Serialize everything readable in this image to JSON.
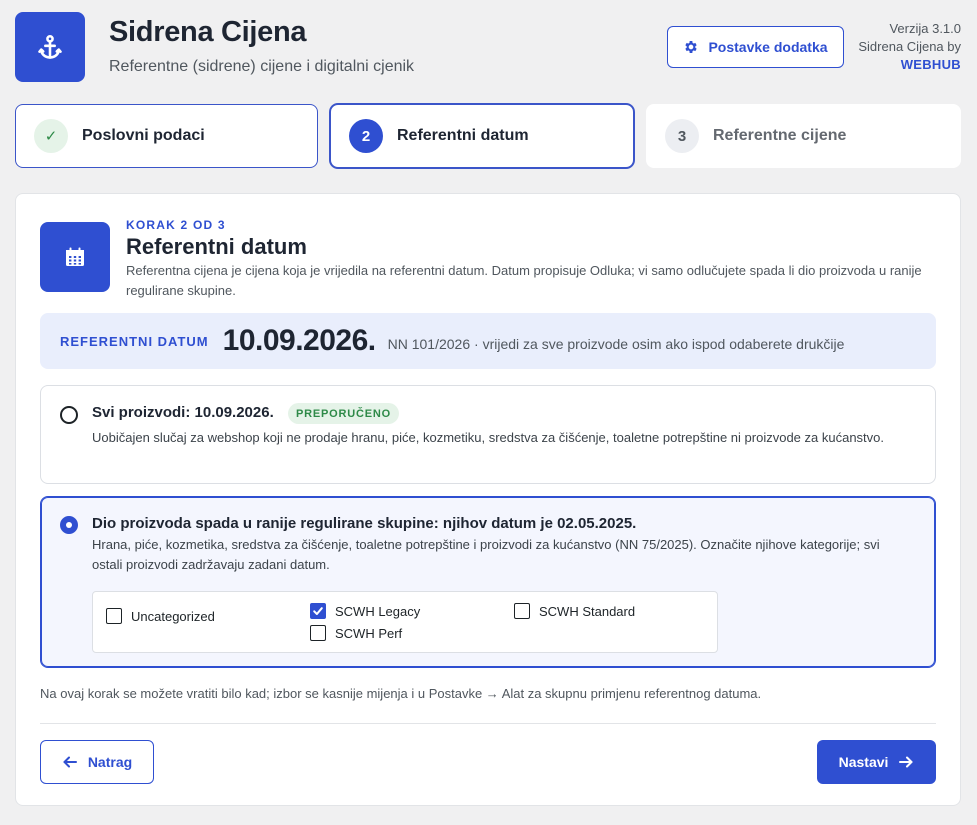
{
  "header": {
    "title": "Sidrena Cijena",
    "subtitle": "Referentne (sidrene) cijene i digitalni cjenik",
    "settings_button": "Postavke dodatka",
    "version": "Verzija 3.1.0",
    "by_line": "Sidrena Cijena by",
    "brand": "WEBHUB",
    "logo_icon": "anchor-icon"
  },
  "steps": [
    {
      "number": "✓",
      "label": "Poslovni podaci",
      "state": "done"
    },
    {
      "number": "2",
      "label": "Referentni datum",
      "state": "active"
    },
    {
      "number": "3",
      "label": "Referentne cijene",
      "state": "pending"
    }
  ],
  "section": {
    "kicker": "KORAK 2 OD 3",
    "title": "Referentni datum",
    "description": "Referentna cijena je cijena koja je vrijedila na referentni datum. Datum propisuje Odluka; vi samo odlučujete spada li dio proizvoda u ranije regulirane skupine.",
    "icon": "calendar-icon"
  },
  "reference": {
    "label": "REFERENTNI DATUM",
    "date": "10.09.2026.",
    "note": "NN 101/2026 · vrijedi za sve proizvode osim ako ispod odaberete drukčije"
  },
  "options": [
    {
      "title": "Svi proizvodi: 10.09.2026.",
      "badge": "PREPORUČENO",
      "description": "Uobičajen slučaj za webshop koji ne prodaje hranu, piće, kozmetiku, sredstva za čišćenje, toaletne potrepštine ni proizvode za kućanstvo.",
      "selected": false
    },
    {
      "title": "Dio proizvoda spada u ranije regulirane skupine: njihov datum je 02.05.2025.",
      "description": "Hrana, piće, kozmetika, sredstva za čišćenje, toaletne potrepštine i proizvodi za kućanstvo (NN 75/2025). Označite njihove kategorije; svi ostali proizvodi zadržavaju zadani datum.",
      "selected": true
    }
  ],
  "categories": [
    {
      "label": "Uncategorized",
      "checked": false
    },
    {
      "label": "SCWH Legacy",
      "checked": true
    },
    {
      "label": "SCWH Perf",
      "checked": false
    },
    {
      "label": "SCWH Standard",
      "checked": false
    }
  ],
  "footnote": "Na ovaj korak se možete vratiti bilo kad; izbor se kasnije mijenja i u Postavke → Alat za skupnu primjenu referentnog datuma.",
  "buttons": {
    "back": "Natrag",
    "next": "Nastavi"
  },
  "colors": {
    "accent": "#2f4fd1",
    "success": "#2e8a48",
    "background": "#f0f0f1"
  }
}
